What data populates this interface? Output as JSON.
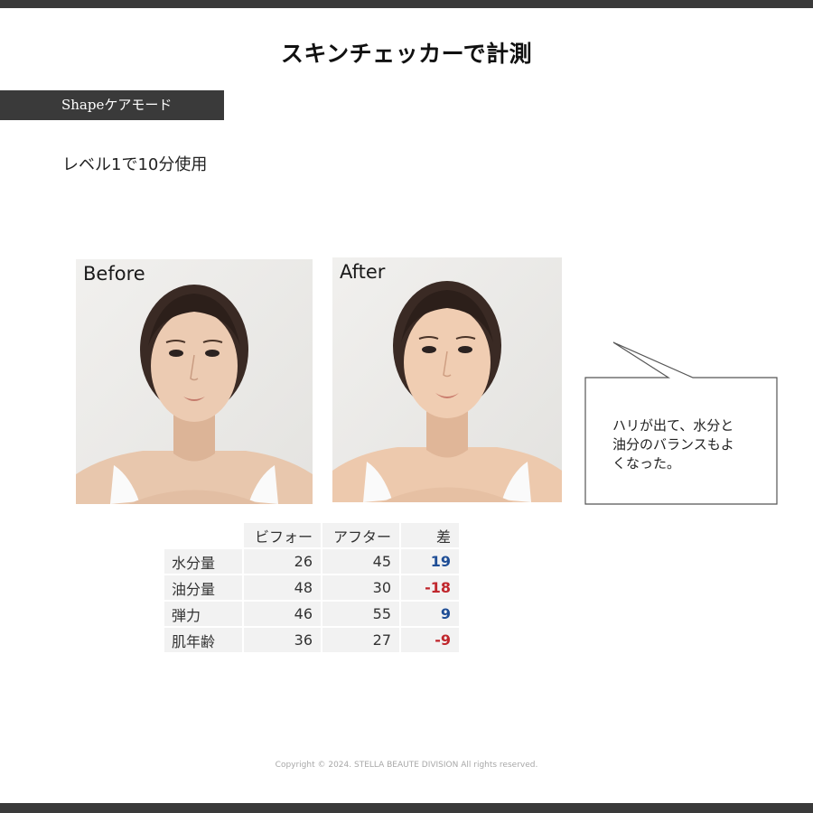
{
  "page": {
    "title": "スキンチェッカーで計測"
  },
  "mode": {
    "label": "Shapeケアモード"
  },
  "usage": {
    "text": "レベル1で10分使用"
  },
  "photos": {
    "before": {
      "label": "Before"
    },
    "after": {
      "label": "After"
    }
  },
  "bubble": {
    "lines": [
      "ハリが出て、水分と",
      "油分のバランスもよ",
      "くなった。"
    ]
  },
  "table": {
    "headers": [
      "ビフォー",
      "アフター",
      "差"
    ],
    "rows": [
      {
        "label": "水分量",
        "before": "26",
        "after": "45",
        "diff": "19",
        "sign": "positive"
      },
      {
        "label": "油分量",
        "before": "48",
        "after": "30",
        "diff": "-18",
        "sign": "negative"
      },
      {
        "label": "弾力",
        "before": "46",
        "after": "55",
        "diff": "9",
        "sign": "positive"
      },
      {
        "label": "肌年齢",
        "before": "36",
        "after": "27",
        "diff": "-9",
        "sign": "negative"
      }
    ]
  },
  "footer": {
    "copyright": "Copyright © 2024. STELLA BEAUTE DIVISION All rights reserved."
  },
  "colors": {
    "bar": "#3a3a3a",
    "positive": "#1f4e96",
    "negative": "#c0272d",
    "cell": "#f2f2f2"
  }
}
